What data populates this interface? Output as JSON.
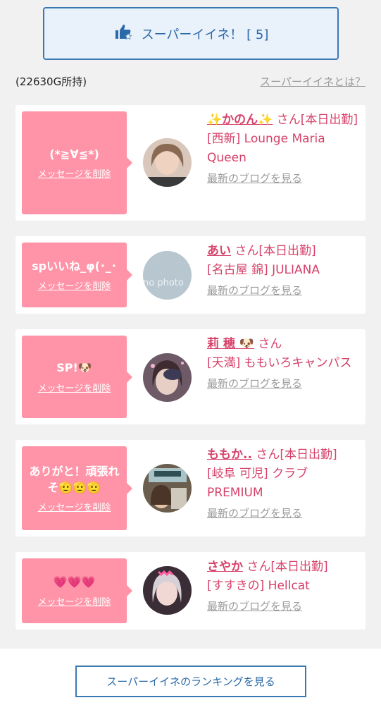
{
  "header": {
    "super_label": "スーパーイイネ！ [ 5]",
    "balance": "(22630G所持)",
    "help_link": "スーパーイイネとは？"
  },
  "cards": [
    {
      "message": "(*≧∀≦*)",
      "delete_label": "メッセージを削除",
      "name": "✨かのん✨",
      "status": " さん[本日出勤]",
      "shop": "[西新] Lounge Maria Queen",
      "blog": "最新のブログを見る"
    },
    {
      "message": "spいいね_φ(･_･",
      "delete_label": "メッセージを削除",
      "name": "あい",
      "status": " さん[本日出勤]",
      "shop": "[名古屋 錦] JULIANA",
      "blog": "最新のブログを見る",
      "avatar_text": "no photo"
    },
    {
      "message": "SP!🐶",
      "delete_label": "メッセージを削除",
      "name": "莉 穂 🐶",
      "status": " さん",
      "shop": "[天満] ももいろキャンパス",
      "blog": "最新のブログを見る"
    },
    {
      "message": "ありがと！頑張れそ🫡🫡🫡",
      "delete_label": "メッセージを削除",
      "name": "ももか..",
      "status": " さん[本日出勤]",
      "shop": "[岐阜 可児] クラブPREMIUM",
      "blog": "最新のブログを見る"
    },
    {
      "message": "💗💗💗",
      "delete_label": "メッセージを削除",
      "name": "さやか",
      "status": " さん[本日出勤]",
      "shop": "[すすきの] Hellcat",
      "blog": "最新のブログを見る"
    }
  ],
  "footer": {
    "ranking_label": "スーパーイイネのランキングを見る"
  },
  "colors": {
    "accent": "#d6416a",
    "bubble": "#ff94a8",
    "button_border": "#3a79b3",
    "button_bg": "#e9f1fb"
  }
}
